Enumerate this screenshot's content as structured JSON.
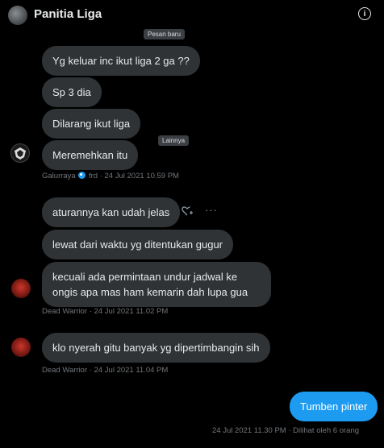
{
  "header": {
    "title": "Panitia Liga",
    "info_icon": "info-circle-icon"
  },
  "tooltips": {
    "new_message": "Pesan baru",
    "more": "Lainnya"
  },
  "messages": [
    {
      "text": "Yg keluar inc ikut liga 2 ga ??"
    },
    {
      "text": "Sp 3 dia"
    },
    {
      "text": "Dilarang ikut liga"
    },
    {
      "text": "Meremehkan itu"
    },
    {
      "text": "aturannya kan udah jelas"
    },
    {
      "text": "lewat dari waktu yg ditentukan gugur"
    },
    {
      "text": "kecuali ada permintaan undur jadwal ke ongis apa mas ham kemarin dah lupa gua"
    },
    {
      "text": "klo nyerah gitu banyak yg dipertimbangin sih"
    },
    {
      "text": "Tumben pinter"
    }
  ],
  "meta": {
    "galurraya_name": "Galurraya",
    "galurraya_rest": "frd · 24 Jul 2021 10.59 PM",
    "dw1": "Dead Warrior · 24 Jul 2021 11.02 PM",
    "dw2": "Dead Warrior · 24 Jul 2021 11.04 PM",
    "own": "24 Jul 2021 11.30 PM · Dilihat oleh 6 orang"
  },
  "colors": {
    "bubble_other": "#2f3336",
    "bubble_own": "#1d9bf0",
    "background": "#000000"
  }
}
